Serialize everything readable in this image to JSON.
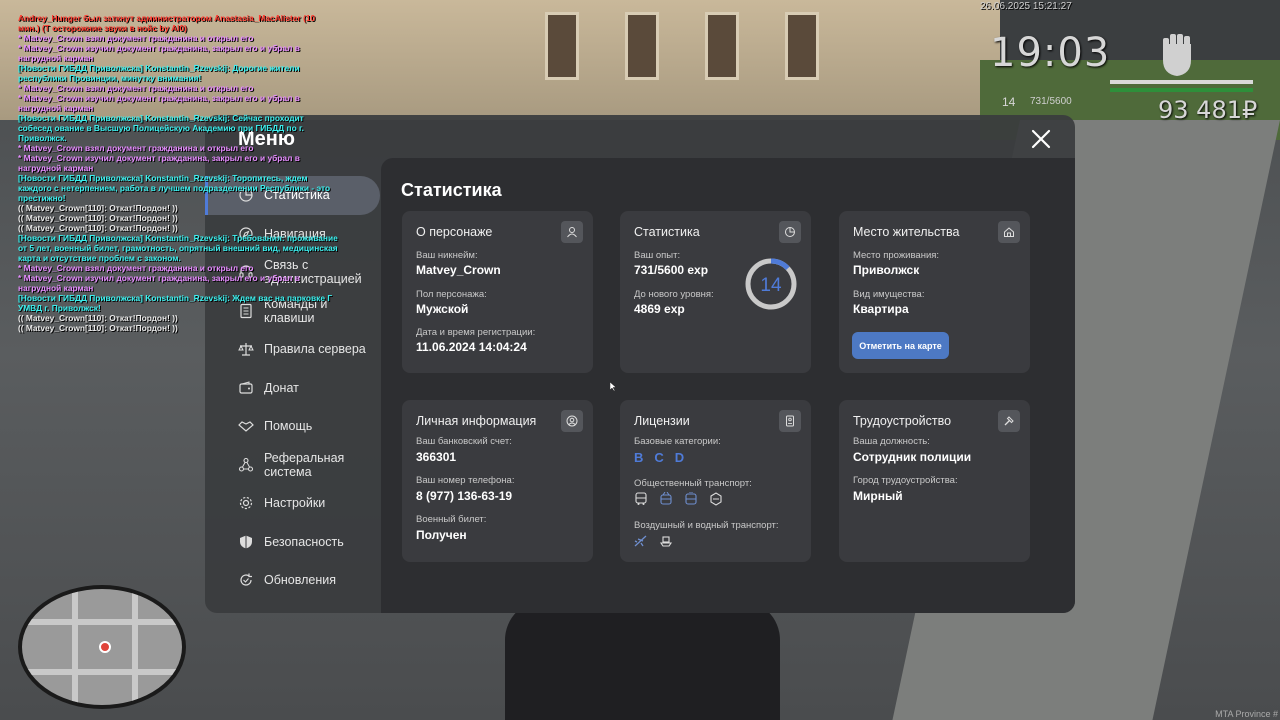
{
  "chat": [
    {
      "color": "red",
      "text": "Andrey_Hunger был заткнут администратором Anastasia_MacAlister (10 мин.) (Т осторожние звуки в нойс by Al0)"
    },
    {
      "color": "pink",
      "text": "* Matvey_Crown взял документ гражданина и открыл его"
    },
    {
      "color": "pink",
      "text": "* Matvey_Crown изучил документ гражданина, закрыл его и убрал в нагрудной карман"
    },
    {
      "color": "cyan",
      "text": "[Новости ГИБДД Приволжска] Konstantin_Rzevskij: Дорогие жители республики Провинции, минутку внимания!"
    },
    {
      "color": "pink",
      "text": "* Matvey_Crown взял документ гражданина и открыл его"
    },
    {
      "color": "pink",
      "text": "* Matvey_Crown изучил документ гражданина, закрыл его и убрал в нагрудной карман"
    },
    {
      "color": "cyan",
      "text": "[Новости ГИБДД Приволжска] Konstantin_Rzevskij: Сейчас проходит собесед ование в Высшую Полицейскую Академию при ГИБДД по г. Приволжск."
    },
    {
      "color": "pink",
      "text": "* Matvey_Crown взял документ гражданина и открыл его"
    },
    {
      "color": "pink",
      "text": "* Matvey_Crown изучил документ гражданина, закрыл его и убрал в нагрудной карман"
    },
    {
      "color": "cyan",
      "text": "[Новости ГИБДД Приволжска] Konstantin_Rzevskij: Торопитесь, ждем каждого с нетерпением, работа в лучшем подразделении Республики - это престижно!"
    },
    {
      "color": "white",
      "text": "(( Matvey_Crown[110]: Откат!Пордон! ))"
    },
    {
      "color": "white",
      "text": "(( Matvey_Crown[110]: Откат!Пордон! ))"
    },
    {
      "color": "white",
      "text": "(( Matvey_Crown[110]: Откат!Пордон! ))"
    },
    {
      "color": "cyan",
      "text": "[Новости ГИБДД Приволжска] Konstantin_Rzevskij: Требования: проживание от 5 лет, военный билет, грамотность, опрятный внешний вид, медицинская карта и отсутствие проблем с законом."
    },
    {
      "color": "pink",
      "text": "* Matvey_Crown взял документ гражданина и открыл его"
    },
    {
      "color": "pink",
      "text": "* Matvey_Crown изучил документ гражданина, закрыл его и убрал в нагрудной карман"
    },
    {
      "color": "cyan",
      "text": "[Новости ГИБДД Приволжска] Konstantin_Rzevskij: Ждем вас на парковке Г УМВД г. Приволжск!"
    },
    {
      "color": "white",
      "text": "(( Matvey_Crown[110]: Откат!Пордон! ))"
    },
    {
      "color": "white",
      "text": "(( Matvey_Crown[110]: Откат!Пордон! ))"
    }
  ],
  "hud": {
    "date": "26.06.2025 15:21:27",
    "time": "19:03",
    "level": "14",
    "exp": "731/5600",
    "money": "93 481₽",
    "watermark": "MTA Province #"
  },
  "menu": {
    "title": "Меню",
    "sidebar": [
      {
        "label": "Статистика",
        "icon": "pie-chart-icon",
        "active": true
      },
      {
        "label": "Навигация",
        "icon": "compass-icon"
      },
      {
        "label": "Связь с администрацией",
        "icon": "headset-icon"
      },
      {
        "label": "Команды и клавиши",
        "icon": "document-icon"
      },
      {
        "label": "Правила сервера",
        "icon": "scales-icon"
      },
      {
        "label": "Донат",
        "icon": "wallet-icon"
      },
      {
        "label": "Помощь",
        "icon": "handshake-icon"
      },
      {
        "label": "Реферальная система",
        "icon": "network-icon"
      },
      {
        "label": "Настройки",
        "icon": "gear-icon"
      },
      {
        "label": "Безопасность",
        "icon": "shield-icon"
      },
      {
        "label": "Обновления",
        "icon": "refresh-icon"
      }
    ]
  },
  "panel": {
    "title": "Статистика",
    "character": {
      "title": "О персонаже",
      "icon": "user-icon",
      "nickname_label": "Ваш никнейм:",
      "nickname": "Matvey_Crown",
      "gender_label": "Пол персонажа:",
      "gender": "Мужской",
      "reg_label": "Дата и время регистрации:",
      "reg": "11.06.2024 14:04:24"
    },
    "stats": {
      "title": "Статистика",
      "icon": "pie-chart-icon",
      "exp_label": "Ваш опыт:",
      "exp": "731/5600 exp",
      "next_label": "До нового уровня:",
      "next": "4869 exp",
      "level": "14",
      "progress": 0.1305
    },
    "residence": {
      "title": "Место жительства",
      "icon": "home-icon",
      "place_label": "Место проживания:",
      "place": "Приволжск",
      "property_label": "Вид имущества:",
      "property": "Квартира",
      "button": "Отметить на карте"
    },
    "personal": {
      "title": "Личная информация",
      "icon": "user-circle-icon",
      "bank_label": "Ваш банковский счет:",
      "bank": "366301",
      "phone_label": "Ваш номер телефона:",
      "phone": "8 (977) 136-63-19",
      "military_label": "Военный билет:",
      "military": "Получен"
    },
    "licenses": {
      "title": "Лицензии",
      "icon": "id-card-icon",
      "base_label": "Базовые категории:",
      "categories": [
        "B",
        "C",
        "D"
      ],
      "public_label": "Общественный транспорт:",
      "air_label": "Воздушный и водный транспорт:"
    },
    "employment": {
      "title": "Трудоустройство",
      "icon": "hammer-icon",
      "position_label": "Ваша должность:",
      "position": "Сотрудник полиции",
      "city_label": "Город трудоустройства:",
      "city": "Мирный"
    }
  }
}
